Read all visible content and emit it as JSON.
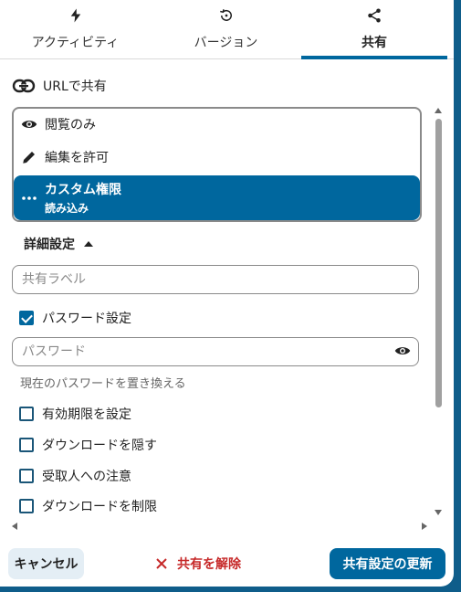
{
  "tabs": [
    {
      "label": "アクティビティ",
      "icon": "lightning-icon"
    },
    {
      "label": "バージョン",
      "icon": "history-icon"
    },
    {
      "label": "共有",
      "icon": "share-icon",
      "active": true
    }
  ],
  "share_url": {
    "label": "URLで共有",
    "icon": "link-icon"
  },
  "permission_options": [
    {
      "label": "閲覧のみ",
      "icon": "eye-icon"
    },
    {
      "label": "編集を許可",
      "icon": "pencil-icon"
    },
    {
      "label": "カスタム権限",
      "sub": "読み込み",
      "icon": "ellipsis-icon",
      "selected": true
    }
  ],
  "advanced": {
    "label": "詳細設定"
  },
  "share_label_field": {
    "placeholder": "共有ラベル",
    "value": ""
  },
  "password_checkbox": {
    "label": "パスワード設定",
    "checked": true
  },
  "password_field": {
    "placeholder": "パスワード",
    "value": ""
  },
  "password_hint": "現在のパスワードを置き換える",
  "checkboxes": [
    {
      "label": "有効期限を設定",
      "checked": false
    },
    {
      "label": "ダウンロードを隠す",
      "checked": false
    },
    {
      "label": "受取人への注意",
      "checked": false
    },
    {
      "label": "ダウンロードを制限",
      "checked": false
    }
  ],
  "footer": {
    "cancel": "キャンセル",
    "unshare": "共有を解除",
    "update": "共有設定の更新"
  },
  "colors": {
    "accent": "#00679e",
    "danger": "#c62828"
  }
}
